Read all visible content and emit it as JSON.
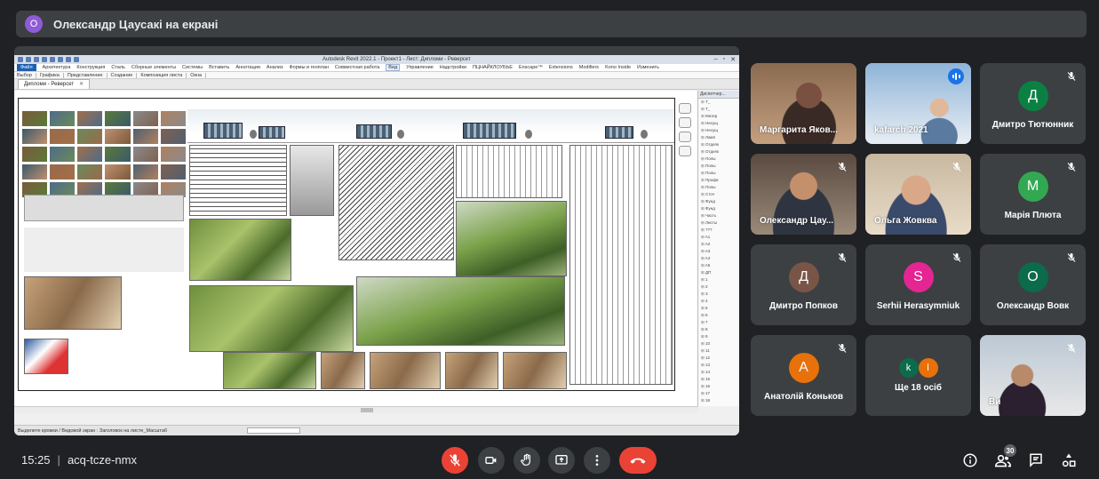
{
  "banner": {
    "avatar_letter": "О",
    "avatar_color": "#8f5bd6",
    "title": "Олександр Цаусакі на екрані"
  },
  "revit": {
    "app_title": "Autodesk Revit 2022.1 - Проект1 - Лист: Дипломи - Реверсет",
    "menu": [
      "Файл",
      "Архитектура",
      "Конструкция",
      "Сталь",
      "Сборные элементы",
      "Системы",
      "Вставить",
      "Аннотации",
      "Анализ",
      "Формы и генплан",
      "Совместная работа",
      "Вид",
      "Управление",
      "Надстройки",
      "ПЦНАЙКЛОУБЬЕ",
      "Enscape™",
      "Extensions",
      "Modifiers",
      "Kono Inside",
      "Изменить"
    ],
    "ribbon": [
      "Выбор",
      "Графика",
      "Представление",
      "Создание",
      "Композиция листа",
      "Окна"
    ],
    "view_tab": "Дипломи - Реверсет",
    "view_tab_close": "✕",
    "status_text": "Выделите кромки / Видовой экран : Заголовок на листе_Масштаб",
    "browser_header": "Диспетчер...",
    "browser_nodes": [
      "Т_",
      "Т_",
      "Матер",
      "Несущ",
      "Несущ",
      "Ламп",
      "Отделк",
      "Отделк",
      "Полы",
      "Полы",
      "Полы",
      "Профи",
      "Полы",
      "Сточ",
      "Фунд",
      "Фунд",
      "Часть",
      "Листы",
      "???",
      "A1",
      "A2",
      "A3",
      "A4",
      "A5",
      "ДП",
      "1",
      "2",
      "3",
      "4",
      "5",
      "6",
      "7",
      "8",
      "9",
      "10",
      "11",
      "12",
      "13",
      "14",
      "15",
      "16",
      "17",
      "18",
      "19",
      "20",
      "21",
      "22",
      "23",
      "Семейс"
    ]
  },
  "participants": [
    {
      "name": "Маргарита Яков...",
      "type": "video",
      "muted": false
    },
    {
      "name": "kafarch 2021",
      "type": "video",
      "speaking": true
    },
    {
      "name": "Дмитро Тютюнник",
      "type": "avatar",
      "letter": "Д",
      "color": "#0b8043",
      "muted": true
    },
    {
      "name": "Олександр Цау...",
      "type": "video",
      "muted": true
    },
    {
      "name": "Ольга Жовква",
      "type": "video",
      "muted": true
    },
    {
      "name": "Марія Плюта",
      "type": "avatar",
      "letter": "М",
      "color": "#33a852",
      "muted": true
    },
    {
      "name": "Дмитро Попков",
      "type": "avatar",
      "letter": "Д",
      "color": "#795548",
      "muted": true
    },
    {
      "name": "Serhii Herasymniuk",
      "type": "avatar",
      "letter": "S",
      "color": "#e52592",
      "muted": true
    },
    {
      "name": "Олександр Вовк",
      "type": "avatar",
      "letter": "О",
      "color": "#0b6b4a",
      "muted": true
    },
    {
      "name": "Анатолій Коньков",
      "type": "avatar",
      "letter": "А",
      "color": "#e8710a",
      "muted": true
    },
    {
      "name": "Ще 18 осіб",
      "type": "more",
      "letters": [
        "k",
        "l"
      ],
      "colors": [
        "#0b6b4a",
        "#e8710a"
      ]
    },
    {
      "name": "Ви",
      "type": "video",
      "muted": true
    }
  ],
  "bottom": {
    "time": "15:25",
    "separator": "|",
    "meeting_code": "acq-tcze-nmx",
    "participant_count": "30"
  },
  "icons": {
    "mic": "mic-off-icon",
    "camera": "camera-icon",
    "hand": "raise-hand-icon",
    "present": "present-screen-icon",
    "more": "more-options-icon",
    "hangup": "hang-up-icon",
    "info": "info-icon",
    "people": "people-icon",
    "chat": "chat-icon",
    "activities": "activities-icon"
  }
}
